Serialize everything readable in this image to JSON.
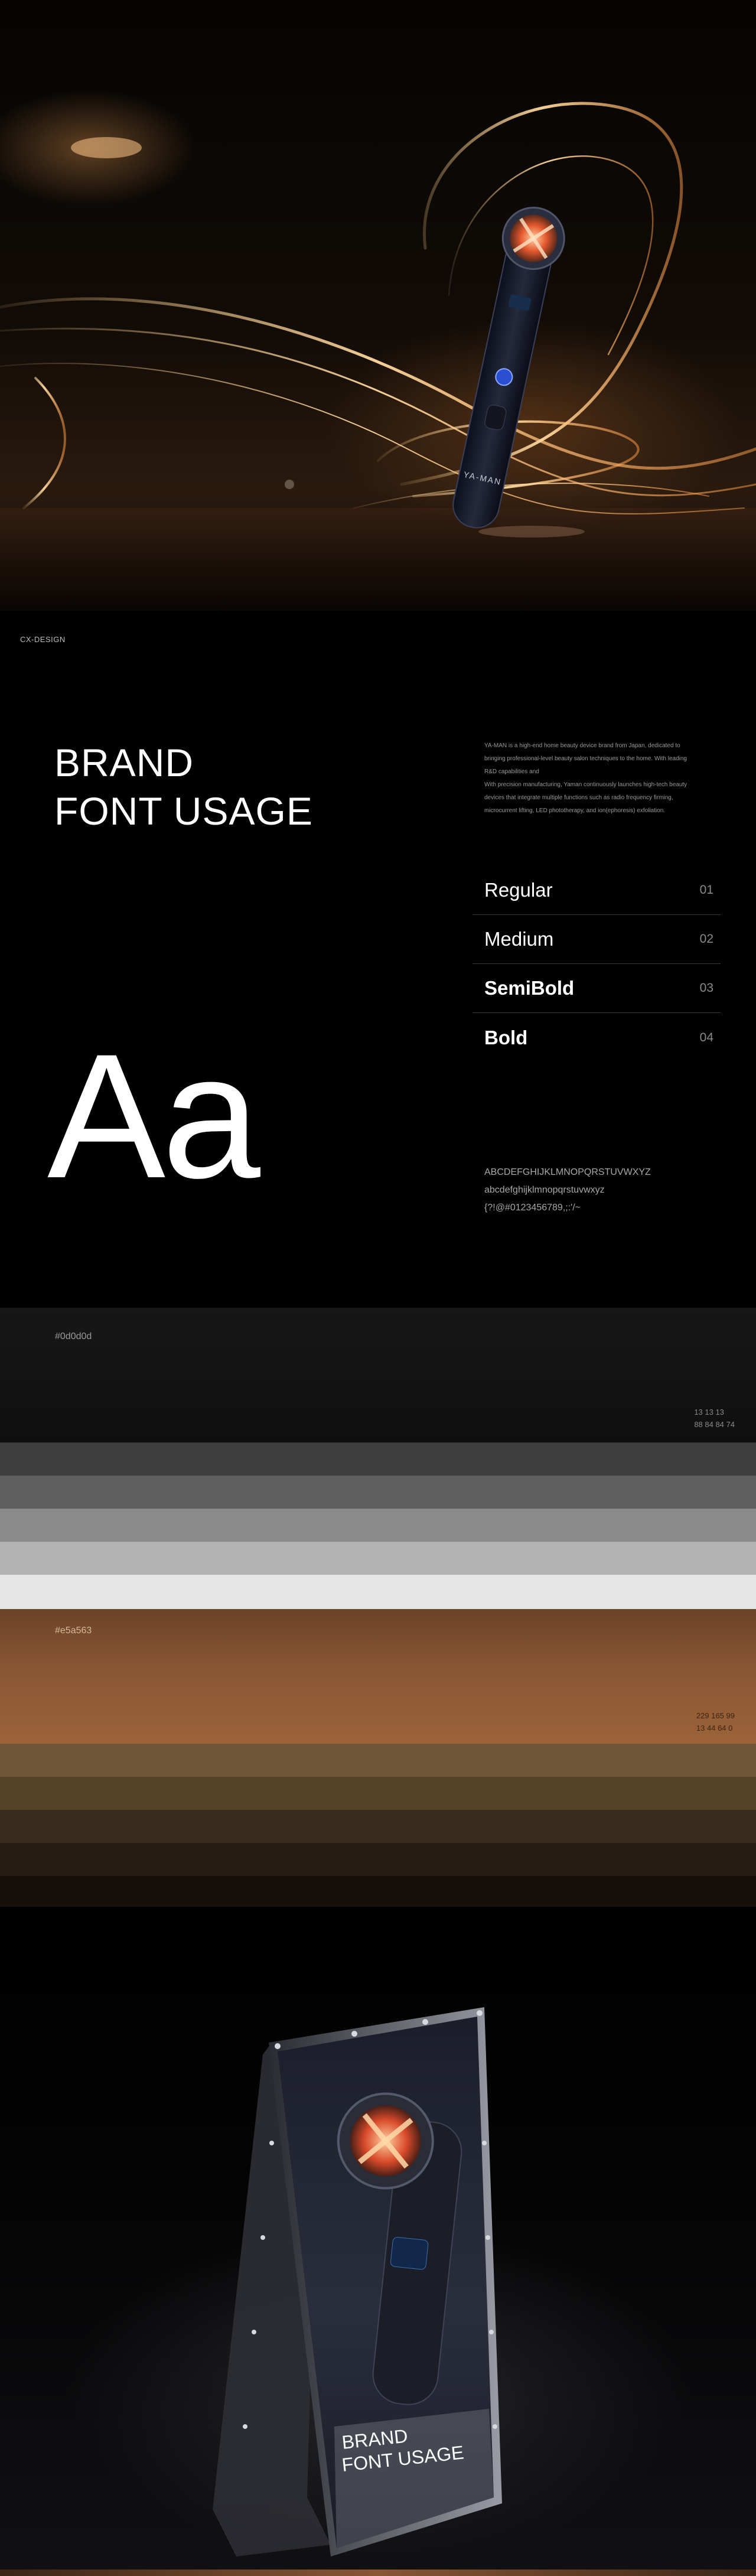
{
  "hero": {
    "device_brand": "YA-MAN"
  },
  "header": {
    "label": "CX-DESIGN"
  },
  "brand": {
    "title_line1": "BRAND",
    "title_line2": "FONT USAGE",
    "description": [
      "YA-MAN is a high-end home beauty device brand from Japan, dedicated to",
      "bringing professional-level beauty salon techniques to the home. With leading",
      "R&D capabilities and",
      "With precision manufacturing, Yaman continuously launches high-tech beauty",
      "devices that integrate multiple functions such as radio frequency firming,",
      "microcurrent lifting, LED phototherapy, and ion(ephoresis) exfoliation."
    ],
    "weights": [
      {
        "name": "Regular",
        "num": "01"
      },
      {
        "name": "Medium",
        "num": "02"
      },
      {
        "name": "SemiBold",
        "num": "03"
      },
      {
        "name": "Bold",
        "num": "04"
      }
    ],
    "specimen": "Aa",
    "charset": [
      "ABCDEFGHIJKLMNOPQRSTUVWXYZ",
      "abcdefghijklmnopqrstuvwxyz",
      "{?!@#0123456789,;:'/~"
    ]
  },
  "palette": {
    "primary": {
      "hex": "#0d0d0d",
      "rgb": "13  13  13",
      "cmyk": "88  84  84  74",
      "tints": [
        "#3d3d3d",
        "#5e5e5e",
        "#8a8a8a",
        "#b3b3b3",
        "#d2d2d2",
        "#e6e6e6"
      ]
    },
    "accent": {
      "hex": "#e5a563",
      "rgb": "229  165  99",
      "cmyk": "13  44  64  0",
      "shades": [
        "#6f5638",
        "#544128",
        "#3a2c1c",
        "#261c13",
        "#170f09"
      ]
    }
  },
  "mockup": {
    "title_line1": "BRAND",
    "title_line2": "FONT USAGE"
  }
}
